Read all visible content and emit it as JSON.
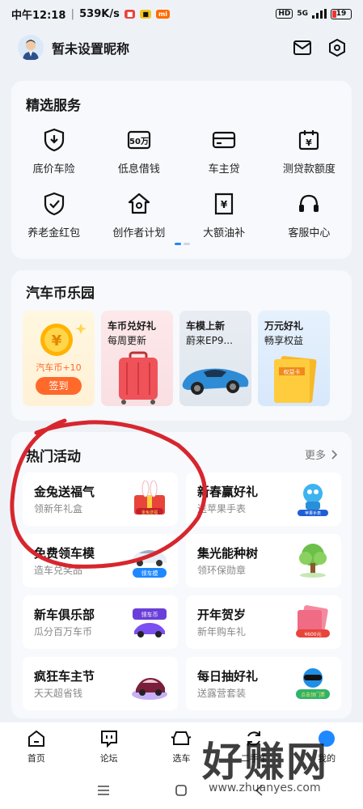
{
  "status_bar": {
    "time": "中午12:18",
    "speed": "539K/s",
    "network": "5G",
    "battery": "19"
  },
  "profile": {
    "nickname": "暂未设置昵称",
    "icons": [
      "mail-icon",
      "settings-hexagon-icon"
    ]
  },
  "services": {
    "title": "精选服务",
    "items": [
      {
        "label": "底价车险",
        "icon": "shield-down-icon"
      },
      {
        "label": "低息借钱",
        "icon": "50-yuan-icon"
      },
      {
        "label": "车主贷",
        "icon": "card-icon"
      },
      {
        "label": "测贷款额度",
        "icon": "calendar-yuan-icon"
      },
      {
        "label": "养老金红包",
        "icon": "shield-check-icon"
      },
      {
        "label": "创作者计划",
        "icon": "creator-house-icon"
      },
      {
        "label": "大额油补",
        "icon": "yuan-doc-icon"
      },
      {
        "label": "客服中心",
        "icon": "headset-icon"
      }
    ]
  },
  "coin_park": {
    "title": "汽车币乐园",
    "checkin": {
      "reward": "汽车币+10",
      "button": "签到"
    },
    "cards": [
      {
        "line1": "车币兑好礼",
        "line2": "每周更新",
        "image": "pink-suitcase"
      },
      {
        "line1": "车模上新",
        "line2": "蔚来EP9...",
        "image": "blue-supercar"
      },
      {
        "line1": "万元好礼",
        "line2": "畅享权益",
        "image": "gift-card",
        "card_text": "权益卡"
      }
    ]
  },
  "hot_events": {
    "title": "热门活动",
    "more": "更多",
    "items": [
      {
        "title": "金兔送福气",
        "subtitle": "领新年礼盒",
        "badge": "金兔送福"
      },
      {
        "title": "新春赢好礼",
        "subtitle": "送苹果手表",
        "badge": "苹果手表"
      },
      {
        "title": "免费领车模",
        "subtitle": "造车兑奖品",
        "badge": "领车模"
      },
      {
        "title": "集光能种树",
        "subtitle": "领环保勋章",
        "badge": ""
      },
      {
        "title": "新车俱乐部",
        "subtitle": "瓜分百万车币",
        "badge": "领车币"
      },
      {
        "title": "开年贺岁",
        "subtitle": "新年购车礼",
        "badge": "¥600元"
      },
      {
        "title": "疯狂车主节",
        "subtitle": "天天超省钱",
        "badge": ""
      },
      {
        "title": "每日抽好礼",
        "subtitle": "送露营套装",
        "badge": "点击领门票"
      }
    ]
  },
  "tabbar": [
    {
      "label": "首页",
      "icon": "home-icon"
    },
    {
      "label": "论坛",
      "icon": "forum-icon"
    },
    {
      "label": "选车",
      "icon": "car-icon"
    },
    {
      "label": "二手车",
      "icon": "refresh-icon"
    },
    {
      "label": "我的",
      "icon": "profile-dot-icon"
    }
  ],
  "watermark": {
    "text": "好赚网",
    "url": "www.zhuanyes.com"
  },
  "colors": {
    "accent": "#ff6a2b",
    "annotation": "#d7262e",
    "primary_blue": "#1e88ff"
  }
}
